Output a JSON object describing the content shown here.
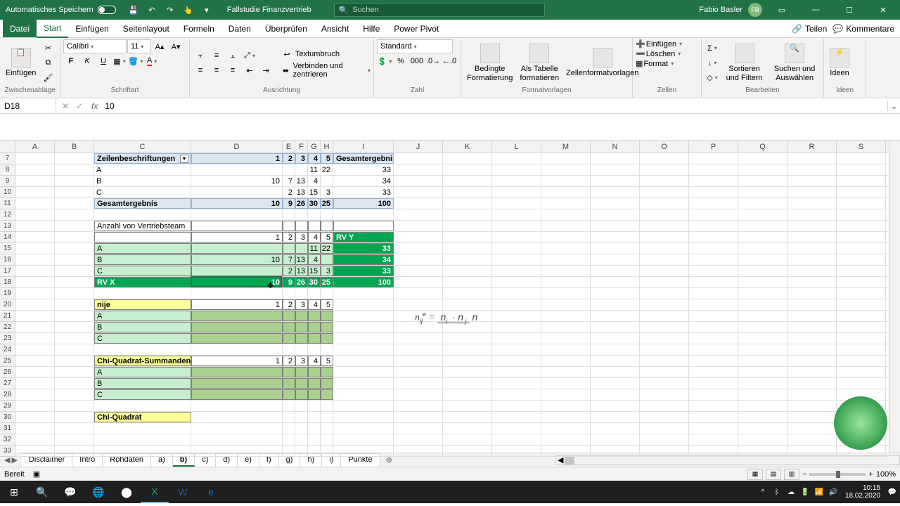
{
  "titlebar": {
    "autosave": "Automatisches Speichern",
    "filename": "Fallstudie Finanzvertrieb",
    "search_placeholder": "Suchen",
    "user": "Fabio Basler",
    "initials": "FB"
  },
  "tabs": {
    "file": "Datei",
    "start": "Start",
    "insert": "Einfügen",
    "layout": "Seitenlayout",
    "formulas": "Formeln",
    "data": "Daten",
    "review": "Überprüfen",
    "view": "Ansicht",
    "help": "Hilfe",
    "pp": "Power Pivot",
    "share": "Teilen",
    "comments": "Kommentare"
  },
  "ribbon": {
    "clipboard": {
      "paste": "Einfügen",
      "label": "Zwischenablage"
    },
    "font": {
      "name": "Calibri",
      "size": "11",
      "label": "Schriftart",
      "bold": "F",
      "italic": "K",
      "underline": "U"
    },
    "align": {
      "wrap": "Textumbruch",
      "merge": "Verbinden und zentrieren",
      "label": "Ausrichtung"
    },
    "number": {
      "format": "Standard",
      "label": "Zahl"
    },
    "styles": {
      "cond": "Bedingte Formatierung",
      "table": "Als Tabelle formatieren",
      "cell": "Zellenformatvorlagen",
      "label": "Formatvorlagen"
    },
    "cells": {
      "insert": "Einfügen",
      "delete": "Löschen",
      "format": "Format",
      "label": "Zellen"
    },
    "editing": {
      "sort": "Sortieren und Filtern",
      "find": "Suchen und Auswählen",
      "label": "Bearbeiten"
    },
    "ideas": {
      "btn": "Ideen",
      "label": "Ideen"
    }
  },
  "namebox": "D18",
  "formula_value": "10",
  "cols": [
    "A",
    "B",
    "C",
    "D",
    "E",
    "F",
    "G",
    "H",
    "I",
    "J",
    "K",
    "L",
    "M",
    "N",
    "O",
    "P",
    "Q",
    "R",
    "S"
  ],
  "rows": [
    "7",
    "8",
    "9",
    "10",
    "11",
    "12",
    "13",
    "14",
    "15",
    "16",
    "17",
    "18",
    "19",
    "20",
    "21",
    "22",
    "23",
    "24",
    "25",
    "26",
    "27",
    "28",
    "29",
    "30",
    "31",
    "32",
    "33"
  ],
  "pivot": {
    "rowlbl": "Zeilenbeschriftungen",
    "h": [
      "1",
      "2",
      "3",
      "4",
      "5"
    ],
    "total": "Gesamtergebnis",
    "r": [
      {
        "n": "A",
        "v": [
          "",
          "",
          "",
          "11",
          "22"
        ],
        "t": "33"
      },
      {
        "n": "B",
        "v": [
          "10",
          "7",
          "13",
          "4",
          ""
        ],
        "t": "34"
      },
      {
        "n": "C",
        "v": [
          "",
          "2",
          "13",
          "15",
          "3"
        ],
        "t": "33"
      }
    ],
    "grand": {
      "n": "Gesamtergebnis",
      "v": [
        "10",
        "9",
        "26",
        "30",
        "25"
      ],
      "t": "100"
    }
  },
  "table2": {
    "title": "Anzahl von Vertriebsteam",
    "h": [
      "1",
      "2",
      "3",
      "4",
      "5"
    ],
    "rvy": "RV Y",
    "r": [
      {
        "n": "A",
        "v": [
          "",
          "",
          "",
          "11",
          "22"
        ],
        "t": "33"
      },
      {
        "n": "B",
        "v": [
          "10",
          "7",
          "13",
          "4",
          ""
        ],
        "t": "34"
      },
      {
        "n": "C",
        "v": [
          "",
          "2",
          "13",
          "15",
          "3"
        ],
        "t": "33"
      }
    ],
    "rvx": {
      "n": "RV X",
      "v": [
        "10",
        "9",
        "26",
        "30",
        "25"
      ],
      "t": "100"
    }
  },
  "table3": {
    "title": "nije",
    "h": [
      "1",
      "2",
      "3",
      "4",
      "5"
    ],
    "r": [
      "A",
      "B",
      "C"
    ]
  },
  "table4": {
    "title": "Chi-Quadrat-Summanden",
    "h": [
      "1",
      "2",
      "3",
      "4",
      "5"
    ],
    "r": [
      "A",
      "B",
      "C"
    ]
  },
  "chiq": "Chi-Quadrat",
  "sheets": {
    "list": [
      "Disclaimer",
      "Intro",
      "Rohdaten",
      "a)",
      "b)",
      "c)",
      "d)",
      "e)",
      "f)",
      "g)",
      "h)",
      "i)",
      "Punkte"
    ],
    "active": "b)"
  },
  "status": {
    "ready": "Bereit",
    "zoom": "100%"
  },
  "tray": {
    "time": "10:15",
    "date": "18.02.2020"
  }
}
